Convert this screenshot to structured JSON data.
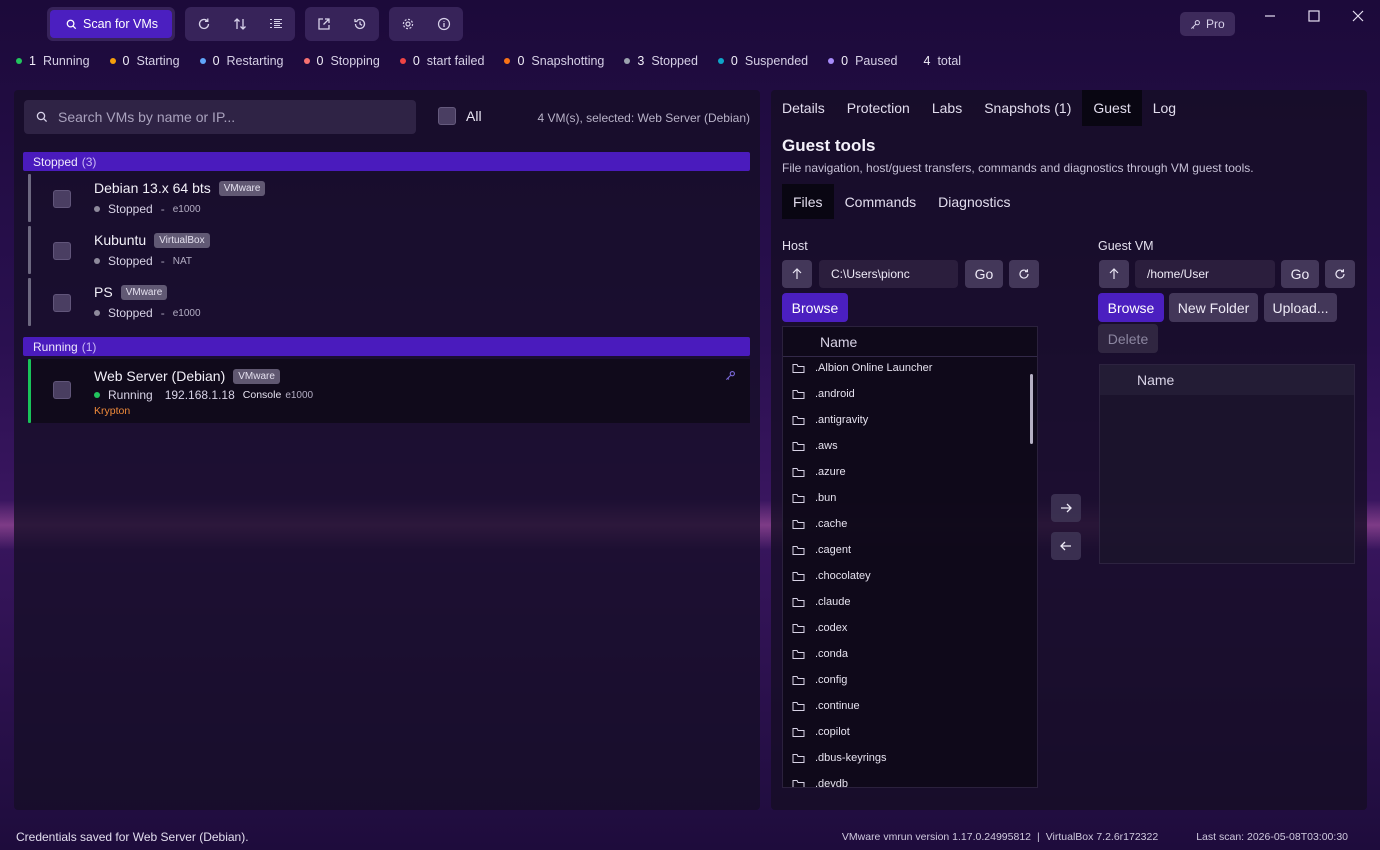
{
  "toolbar": {
    "scan_label": "Scan for VMs",
    "pro_label": "Pro"
  },
  "status": [
    {
      "count": "1",
      "label": "Running",
      "color": "#22c55e"
    },
    {
      "count": "0",
      "label": "Starting",
      "color": "#f59e0b"
    },
    {
      "count": "0",
      "label": "Restarting",
      "color": "#60a5fa"
    },
    {
      "count": "0",
      "label": "Stopping",
      "color": "#f87171"
    },
    {
      "count": "0",
      "label": "start failed",
      "color": "#ef4444"
    },
    {
      "count": "0",
      "label": "Snapshotting",
      "color": "#f97316"
    },
    {
      "count": "3",
      "label": "Stopped",
      "color": "#9ca3af"
    },
    {
      "count": "0",
      "label": "Suspended",
      "color": "#0ea5c9"
    },
    {
      "count": "0",
      "label": "Paused",
      "color": "#a78bfa"
    },
    {
      "count": "4",
      "label": "total",
      "color": ""
    }
  ],
  "left": {
    "search_placeholder": "Search VMs by name or IP...",
    "all_label": "All",
    "vm_count": "4 VM(s), selected: Web Server (Debian)",
    "groups": {
      "stopped": {
        "label": "Stopped",
        "count": "(3)"
      },
      "running": {
        "label": "Running",
        "count": "(1)"
      }
    },
    "vms": [
      {
        "name": "Debian 13.x 64 bts",
        "badge": "VMware",
        "state": "Stopped",
        "dash": "-",
        "net": "e1000"
      },
      {
        "name": "Kubuntu",
        "badge": "VirtualBox",
        "state": "Stopped",
        "dash": "-",
        "net": "NAT"
      },
      {
        "name": "PS",
        "badge": "VMware",
        "state": "Stopped",
        "dash": "-",
        "net": "e1000"
      },
      {
        "name": "Web Server (Debian)",
        "badge": "VMware",
        "state": "Running",
        "ip": "192.168.1.18",
        "console": "Console",
        "net": "e1000",
        "tag": "Krypton"
      }
    ]
  },
  "right": {
    "tabs": [
      "Details",
      "Protection",
      "Labs",
      "Snapshots (1)",
      "Guest",
      "Log"
    ],
    "title": "Guest tools",
    "description": "File navigation, host/guest transfers, commands and diagnostics through VM guest tools.",
    "subtabs": [
      "Files",
      "Commands",
      "Diagnostics"
    ],
    "host": {
      "label": "Host",
      "path": "C:\\Users\\pionc",
      "go": "Go",
      "browse": "Browse",
      "column": "Name",
      "files": [
        ".Albion Online Launcher",
        ".android",
        ".antigravity",
        ".aws",
        ".azure",
        ".bun",
        ".cache",
        ".cagent",
        ".chocolatey",
        ".claude",
        ".codex",
        ".conda",
        ".config",
        ".continue",
        ".copilot",
        ".dbus-keyrings",
        ".devdb"
      ]
    },
    "guest": {
      "label": "Guest VM",
      "path": "/home/User",
      "go": "Go",
      "browse": "Browse",
      "new_folder": "New Folder",
      "upload": "Upload...",
      "delete": "Delete",
      "column": "Name"
    }
  },
  "footer": {
    "message": "Credentials saved for Web Server (Debian).",
    "vmware": "VMware vmrun version 1.17.0.24995812",
    "sep": "|",
    "vbox": "VirtualBox 7.2.6r172322",
    "last_scan": "Last scan: 2026-05-08T03:00:30"
  }
}
